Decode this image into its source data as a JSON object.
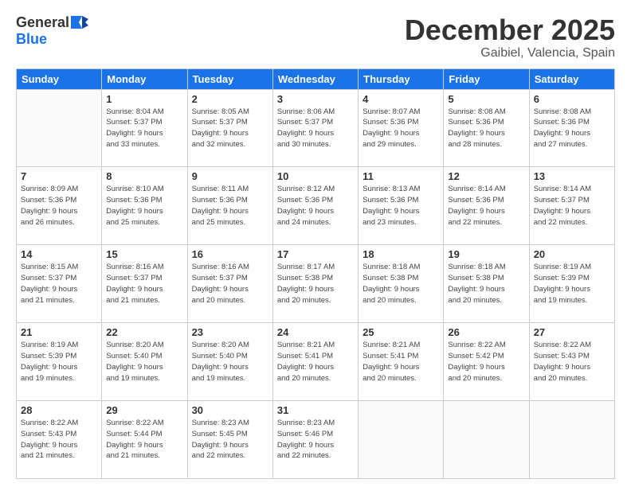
{
  "header": {
    "logo_line1": "General",
    "logo_line2": "Blue",
    "month": "December 2025",
    "location": "Gaibiel, Valencia, Spain"
  },
  "weekdays": [
    "Sunday",
    "Monday",
    "Tuesday",
    "Wednesday",
    "Thursday",
    "Friday",
    "Saturday"
  ],
  "weeks": [
    [
      {
        "day": "",
        "info": ""
      },
      {
        "day": "1",
        "info": "Sunrise: 8:04 AM\nSunset: 5:37 PM\nDaylight: 9 hours\nand 33 minutes."
      },
      {
        "day": "2",
        "info": "Sunrise: 8:05 AM\nSunset: 5:37 PM\nDaylight: 9 hours\nand 32 minutes."
      },
      {
        "day": "3",
        "info": "Sunrise: 8:06 AM\nSunset: 5:37 PM\nDaylight: 9 hours\nand 30 minutes."
      },
      {
        "day": "4",
        "info": "Sunrise: 8:07 AM\nSunset: 5:36 PM\nDaylight: 9 hours\nand 29 minutes."
      },
      {
        "day": "5",
        "info": "Sunrise: 8:08 AM\nSunset: 5:36 PM\nDaylight: 9 hours\nand 28 minutes."
      },
      {
        "day": "6",
        "info": "Sunrise: 8:08 AM\nSunset: 5:36 PM\nDaylight: 9 hours\nand 27 minutes."
      }
    ],
    [
      {
        "day": "7",
        "info": "Sunrise: 8:09 AM\nSunset: 5:36 PM\nDaylight: 9 hours\nand 26 minutes."
      },
      {
        "day": "8",
        "info": "Sunrise: 8:10 AM\nSunset: 5:36 PM\nDaylight: 9 hours\nand 25 minutes."
      },
      {
        "day": "9",
        "info": "Sunrise: 8:11 AM\nSunset: 5:36 PM\nDaylight: 9 hours\nand 25 minutes."
      },
      {
        "day": "10",
        "info": "Sunrise: 8:12 AM\nSunset: 5:36 PM\nDaylight: 9 hours\nand 24 minutes."
      },
      {
        "day": "11",
        "info": "Sunrise: 8:13 AM\nSunset: 5:36 PM\nDaylight: 9 hours\nand 23 minutes."
      },
      {
        "day": "12",
        "info": "Sunrise: 8:14 AM\nSunset: 5:36 PM\nDaylight: 9 hours\nand 22 minutes."
      },
      {
        "day": "13",
        "info": "Sunrise: 8:14 AM\nSunset: 5:37 PM\nDaylight: 9 hours\nand 22 minutes."
      }
    ],
    [
      {
        "day": "14",
        "info": "Sunrise: 8:15 AM\nSunset: 5:37 PM\nDaylight: 9 hours\nand 21 minutes."
      },
      {
        "day": "15",
        "info": "Sunrise: 8:16 AM\nSunset: 5:37 PM\nDaylight: 9 hours\nand 21 minutes."
      },
      {
        "day": "16",
        "info": "Sunrise: 8:16 AM\nSunset: 5:37 PM\nDaylight: 9 hours\nand 20 minutes."
      },
      {
        "day": "17",
        "info": "Sunrise: 8:17 AM\nSunset: 5:38 PM\nDaylight: 9 hours\nand 20 minutes."
      },
      {
        "day": "18",
        "info": "Sunrise: 8:18 AM\nSunset: 5:38 PM\nDaylight: 9 hours\nand 20 minutes."
      },
      {
        "day": "19",
        "info": "Sunrise: 8:18 AM\nSunset: 5:38 PM\nDaylight: 9 hours\nand 20 minutes."
      },
      {
        "day": "20",
        "info": "Sunrise: 8:19 AM\nSunset: 5:39 PM\nDaylight: 9 hours\nand 19 minutes."
      }
    ],
    [
      {
        "day": "21",
        "info": "Sunrise: 8:19 AM\nSunset: 5:39 PM\nDaylight: 9 hours\nand 19 minutes."
      },
      {
        "day": "22",
        "info": "Sunrise: 8:20 AM\nSunset: 5:40 PM\nDaylight: 9 hours\nand 19 minutes."
      },
      {
        "day": "23",
        "info": "Sunrise: 8:20 AM\nSunset: 5:40 PM\nDaylight: 9 hours\nand 19 minutes."
      },
      {
        "day": "24",
        "info": "Sunrise: 8:21 AM\nSunset: 5:41 PM\nDaylight: 9 hours\nand 20 minutes."
      },
      {
        "day": "25",
        "info": "Sunrise: 8:21 AM\nSunset: 5:41 PM\nDaylight: 9 hours\nand 20 minutes."
      },
      {
        "day": "26",
        "info": "Sunrise: 8:22 AM\nSunset: 5:42 PM\nDaylight: 9 hours\nand 20 minutes."
      },
      {
        "day": "27",
        "info": "Sunrise: 8:22 AM\nSunset: 5:43 PM\nDaylight: 9 hours\nand 20 minutes."
      }
    ],
    [
      {
        "day": "28",
        "info": "Sunrise: 8:22 AM\nSunset: 5:43 PM\nDaylight: 9 hours\nand 21 minutes."
      },
      {
        "day": "29",
        "info": "Sunrise: 8:22 AM\nSunset: 5:44 PM\nDaylight: 9 hours\nand 21 minutes."
      },
      {
        "day": "30",
        "info": "Sunrise: 8:23 AM\nSunset: 5:45 PM\nDaylight: 9 hours\nand 22 minutes."
      },
      {
        "day": "31",
        "info": "Sunrise: 8:23 AM\nSunset: 5:46 PM\nDaylight: 9 hours\nand 22 minutes."
      },
      {
        "day": "",
        "info": ""
      },
      {
        "day": "",
        "info": ""
      },
      {
        "day": "",
        "info": ""
      }
    ]
  ]
}
